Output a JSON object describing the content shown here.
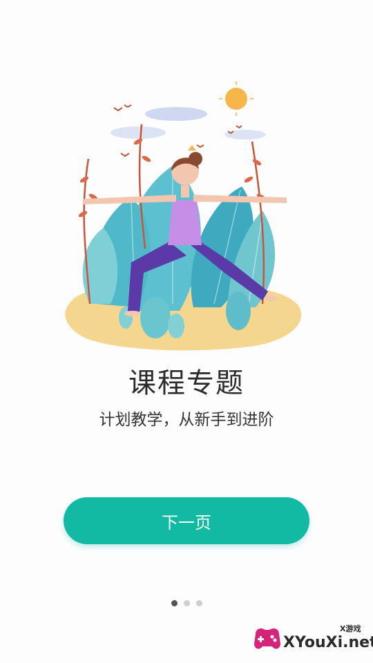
{
  "onboarding": {
    "title": "课程专题",
    "subtitle": "计划教学，从新手到进阶",
    "next_button_label": "下一页",
    "page_indicator": {
      "total": 3,
      "current": 1
    }
  },
  "illustration": {
    "icon": "yoga-pose-illustration"
  },
  "watermark": {
    "text": "XYouXi.net",
    "small_text": "X游戏"
  },
  "colors": {
    "accent": "#12b9a3",
    "title": "#2b2b2b"
  }
}
